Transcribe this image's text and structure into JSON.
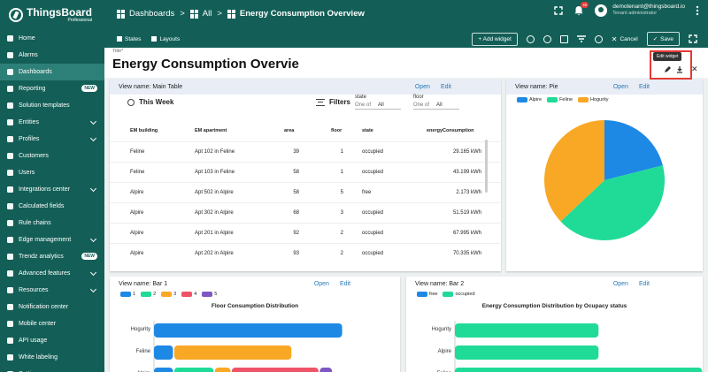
{
  "header": {
    "logo_name": "ThingsBoard",
    "logo_sub": "Professional",
    "breadcrumb": [
      "Dashboards",
      ">",
      "All",
      ">",
      "Energy Consumption Overview"
    ],
    "notification_count": "40",
    "user_email": "demotenant@thingsboard.io",
    "user_role": "Tenant administrator"
  },
  "sidebar": {
    "items": [
      {
        "label": "Home",
        "icon": "home-icon"
      },
      {
        "label": "Alarms",
        "icon": "alarm-icon"
      },
      {
        "label": "Dashboards",
        "icon": "dashboard-icon",
        "active": true
      },
      {
        "label": "Reporting",
        "icon": "report-icon",
        "badge": "NEW"
      },
      {
        "label": "Solution templates",
        "icon": "template-icon"
      },
      {
        "label": "Entities",
        "icon": "entities-icon",
        "chevron": true
      },
      {
        "label": "Profiles",
        "icon": "profiles-icon",
        "chevron": true
      },
      {
        "label": "Customers",
        "icon": "customers-icon"
      },
      {
        "label": "Users",
        "icon": "users-icon"
      },
      {
        "label": "Integrations center",
        "icon": "integrations-icon",
        "chevron": true
      },
      {
        "label": "Calculated fields",
        "icon": "function-icon"
      },
      {
        "label": "Rule chains",
        "icon": "rule-chain-icon"
      },
      {
        "label": "Edge management",
        "icon": "edge-icon",
        "chevron": true
      },
      {
        "label": "Trendz analytics",
        "icon": "trendz-icon",
        "badge": "NEW"
      },
      {
        "label": "Advanced features",
        "icon": "advanced-icon",
        "chevron": true
      },
      {
        "label": "Resources",
        "icon": "resources-icon",
        "chevron": true
      },
      {
        "label": "Notification center",
        "icon": "notification-icon"
      },
      {
        "label": "Mobile center",
        "icon": "mobile-icon"
      },
      {
        "label": "API usage",
        "icon": "api-icon"
      },
      {
        "label": "White labeling",
        "icon": "white-label-icon"
      },
      {
        "label": "Settings",
        "icon": "settings-icon"
      }
    ]
  },
  "toolbar": {
    "states": "States",
    "layouts": "Layouts",
    "add_widget": "+ Add widget",
    "cancel": "Cancel",
    "save": "Save"
  },
  "dashboard": {
    "title_label": "Title*",
    "title_value": "Energy Consumption Overvie",
    "edit_tooltip": "Edit widget"
  },
  "main_table": {
    "view_name": "View name: Main Table",
    "open": "Open",
    "edit": "Edit",
    "time_label": "This Week",
    "filters_label": "Filters",
    "filter_state_label": "state",
    "filter_state_prefix": "One of",
    "filter_state_value": "All",
    "filter_floor_label": "floor",
    "filter_floor_prefix": "One of",
    "filter_floor_value": "All",
    "columns": [
      "EM building",
      "EM apartment",
      "area",
      "floor",
      "state",
      "energyConsumption"
    ],
    "rows": [
      [
        "Feline",
        "Apt 102 in Feline",
        "39",
        "1",
        "occupied",
        "29.165 kWh"
      ],
      [
        "Feline",
        "Apt 103 in Feline",
        "58",
        "1",
        "occupied",
        "43.199 kWh"
      ],
      [
        "Alpire",
        "Apt 502 in Alpire",
        "58",
        "5",
        "free",
        "2.173 kWh"
      ],
      [
        "Alpire",
        "Apt 302 in Alpire",
        "68",
        "3",
        "occupied",
        "51.519 kWh"
      ],
      [
        "Alpire",
        "Apt 201 in Alpire",
        "92",
        "2",
        "occupied",
        "67.995 kWh"
      ],
      [
        "Alpire",
        "Apt 202 in Alpire",
        "93",
        "2",
        "occupied",
        "70.335 kWh"
      ]
    ]
  },
  "pie": {
    "view_name": "View name: Pie",
    "open": "Open",
    "edit": "Edit"
  },
  "bar1": {
    "view_name": "View name: Bar 1",
    "open": "Open",
    "edit": "Edit"
  },
  "bar2": {
    "view_name": "View name: Bar 2",
    "open": "Open",
    "edit": "Edit"
  },
  "chart_data": [
    {
      "type": "pie",
      "title": "",
      "categories": [
        "Alpire",
        "Feline",
        "Hogurity"
      ],
      "values": [
        21,
        42,
        37
      ],
      "colors": [
        "#1e88e5",
        "#1fdb97",
        "#f9a825"
      ],
      "legend": "top-left"
    },
    {
      "type": "bar",
      "orientation": "horizontal-stacked",
      "title": "Floor Consumption Distribution",
      "categories": [
        "Hogurity",
        "Feline",
        "Alpire"
      ],
      "series": [
        {
          "name": "1",
          "values": [
            280,
            30,
            30
          ]
        },
        {
          "name": "2",
          "values": [
            0,
            0,
            60
          ]
        },
        {
          "name": "3",
          "values": [
            0,
            175,
            25
          ]
        },
        {
          "name": "4",
          "values": [
            0,
            0,
            130
          ]
        },
        {
          "name": "5",
          "values": [
            0,
            0,
            20
          ]
        }
      ],
      "colors": [
        "#1e88e5",
        "#1fdb97",
        "#f9a825",
        "#ef5367",
        "#7e57c2"
      ],
      "legend": "top-left"
    },
    {
      "type": "bar",
      "orientation": "horizontal-stacked",
      "title": "Energy Consumption Distribution by Ocupacy status",
      "categories": [
        "Hogurity",
        "Alpire",
        "Feline"
      ],
      "series": [
        {
          "name": "free",
          "values": [
            0,
            0,
            0
          ]
        },
        {
          "name": "occupied",
          "values": [
            210,
            210,
            360
          ]
        }
      ],
      "colors": [
        "#1e88e5",
        "#1fdb97"
      ],
      "legend": "top-left"
    }
  ]
}
